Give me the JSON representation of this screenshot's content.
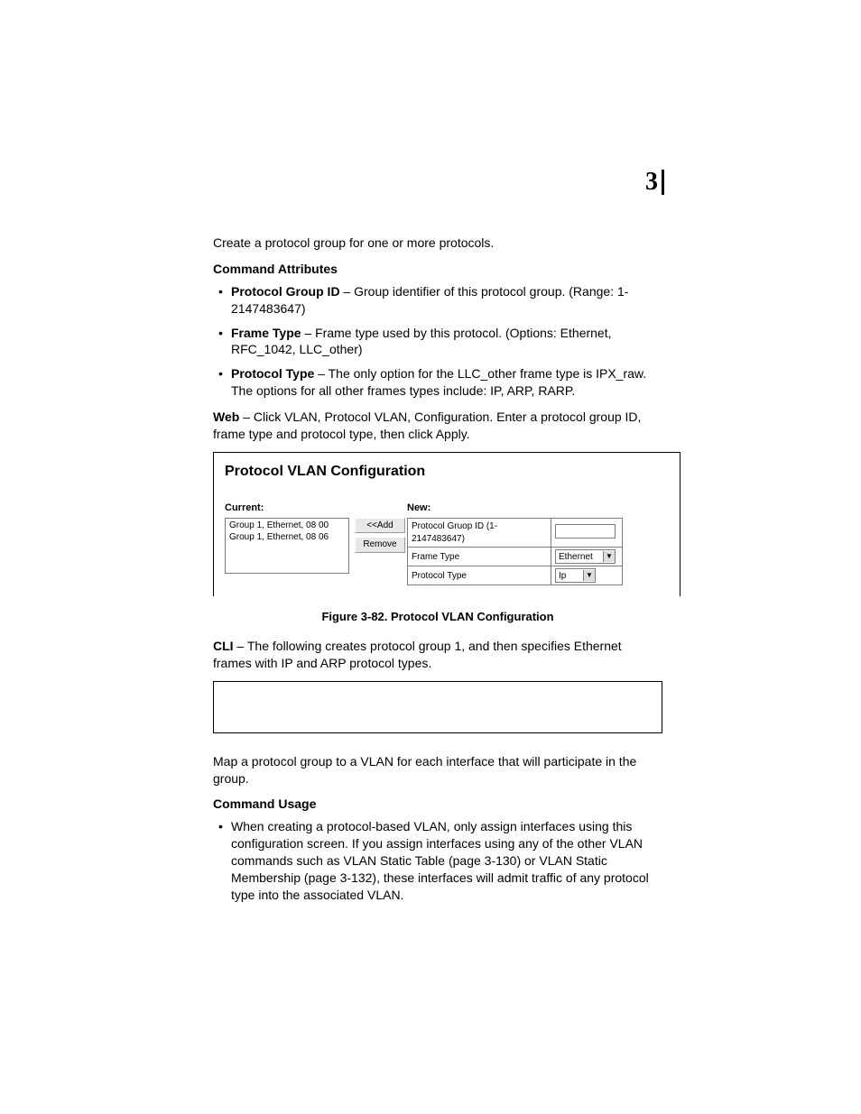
{
  "chapter_number": "3",
  "intro": "Create a protocol group for one or more protocols.",
  "cmd_attr_heading": "Command Attributes",
  "attrs": [
    {
      "name": "Protocol Group ID",
      "desc": " – Group identifier of this protocol group. (Range: 1-2147483647)"
    },
    {
      "name": "Frame Type",
      "desc": " – Frame type used by this protocol. (Options: Ethernet, RFC_1042, LLC_other)"
    },
    {
      "name": "Protocol Type",
      "desc": " – The only option for the LLC_other frame type is IPX_raw. The options for all other frames types include: IP, ARP, RARP."
    }
  ],
  "web_label": "Web",
  "web_text": " – Click VLAN, Protocol VLAN, Configuration. Enter a protocol group ID, frame type and protocol type, then click Apply.",
  "figure": {
    "title": "Protocol VLAN Configuration",
    "current_label": "Current:",
    "new_label": "New:",
    "list_items": [
      "Group 1, Ethernet, 08 00",
      "Group 1, Ethernet, 08 06"
    ],
    "add_btn": "<<Add",
    "remove_btn": "Remove",
    "row1_label": "Protocol Gruop ID (1-2147483647)",
    "row2_label": "Frame Type",
    "row2_value": "Ethernet",
    "row3_label": "Protocol Type",
    "row3_value": "Ip",
    "caption": "Figure 3-82.  Protocol VLAN Configuration"
  },
  "cli_label": "CLI",
  "cli_text": " – The following creates protocol group 1, and then specifies Ethernet frames with IP and ARP protocol types.",
  "map_text": "Map a protocol group to a VLAN for each interface that will participate in the group.",
  "cmd_usage_heading": "Command Usage",
  "usage_bullet": "When creating a protocol-based VLAN, only assign interfaces using this configuration screen. If you assign interfaces using any of the other VLAN commands such as VLAN Static Table (page 3-130) or VLAN Static Membership (page 3-132), these interfaces will admit traffic of any protocol type into the associated VLAN."
}
